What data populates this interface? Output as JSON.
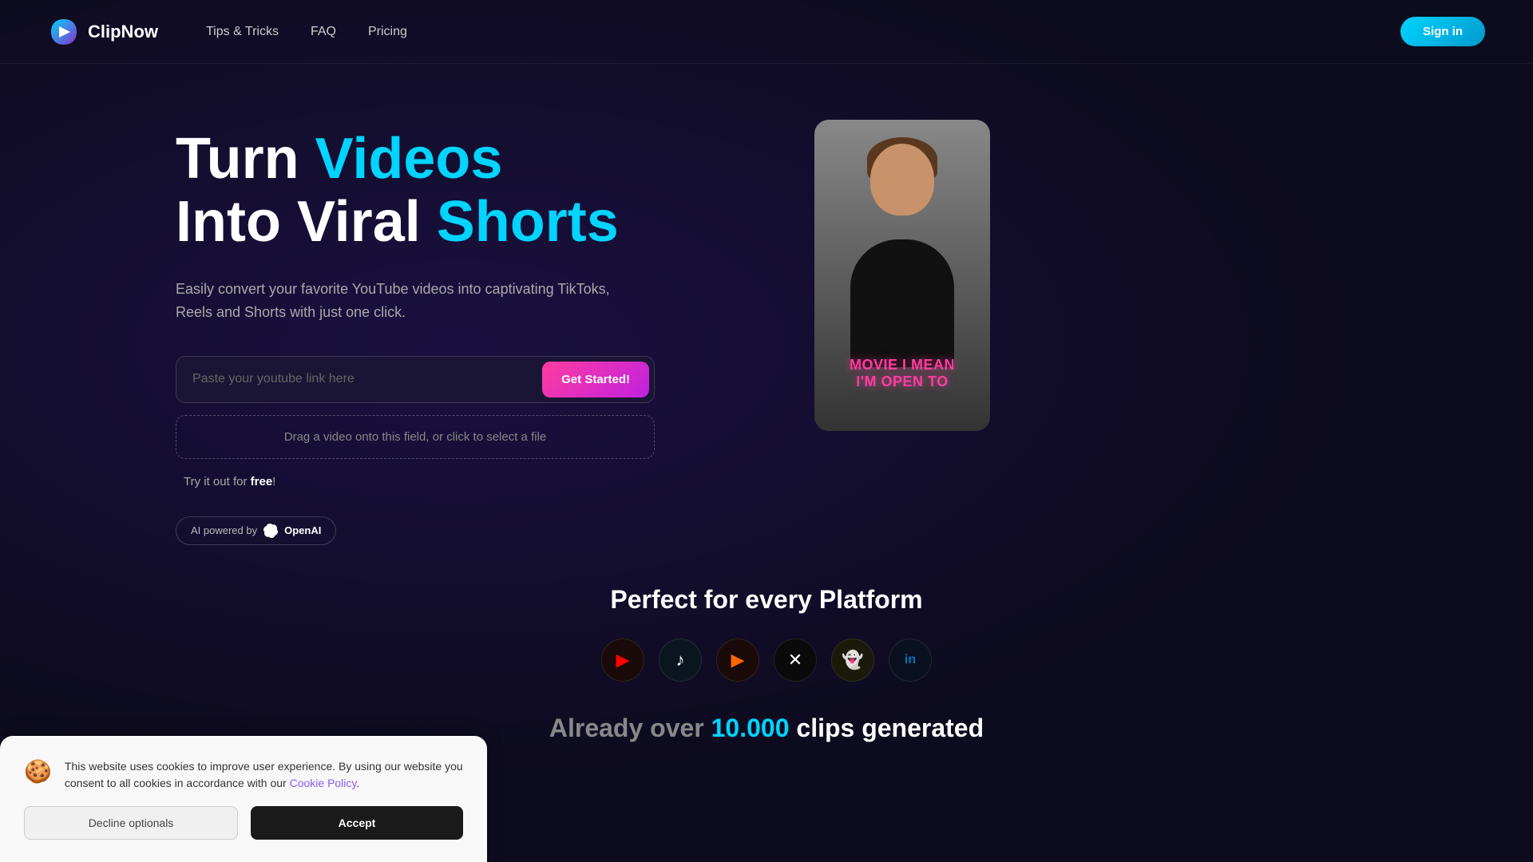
{
  "nav": {
    "logo_text": "ClipNow",
    "links": [
      {
        "label": "Tips & Tricks",
        "id": "tips-tricks"
      },
      {
        "label": "FAQ",
        "id": "faq"
      },
      {
        "label": "Pricing",
        "id": "pricing"
      }
    ],
    "sign_in_label": "Sign in"
  },
  "hero": {
    "title_line1_plain": "Turn ",
    "title_line1_highlight": "Videos",
    "title_line2_plain": "Into Viral ",
    "title_line2_highlight": "Shorts",
    "subtitle": "Easily convert your favorite YouTube videos into captivating TikToks, Reels and Shorts with just one click.",
    "input_placeholder": "Paste your youtube link here",
    "get_started_label": "Get Started!",
    "drop_zone_text": "Drag a video onto this field, or click to select a file",
    "free_text_prefix": "Try it out for ",
    "free_text_highlight": "free",
    "free_text_suffix": "!",
    "openai_badge_text": "AI powered by",
    "openai_name": "OpenAI"
  },
  "video_preview": {
    "caption_line1": "MOVIE I MEAN",
    "caption_line2": "I'M OPEN TO"
  },
  "platform_section": {
    "title": "Perfect for every Platform",
    "icons": [
      {
        "name": "YouTube",
        "symbol": "▶",
        "class": "youtube"
      },
      {
        "name": "TikTok",
        "symbol": "♪",
        "class": "tiktok"
      },
      {
        "name": "YouTube Shorts",
        "symbol": "▶",
        "class": "youtube2"
      },
      {
        "name": "Twitter/X",
        "symbol": "✕",
        "class": "twitter"
      },
      {
        "name": "Snapchat",
        "symbol": "👻",
        "class": "snapchat"
      },
      {
        "name": "LinkedIn",
        "symbol": "in",
        "class": "linkedin"
      }
    ]
  },
  "clips_counter": {
    "prefix": "Already over ",
    "number": "10.000",
    "suffix": " clips generated"
  },
  "cookie_banner": {
    "emoji": "🍪",
    "text_before_link": "This website uses cookies to improve user experience. By using our website you consent to all cookies in accordance with our ",
    "link_text": "Cookie Policy",
    "text_after_link": ".",
    "decline_label": "Decline optionals",
    "accept_label": "Accept"
  }
}
